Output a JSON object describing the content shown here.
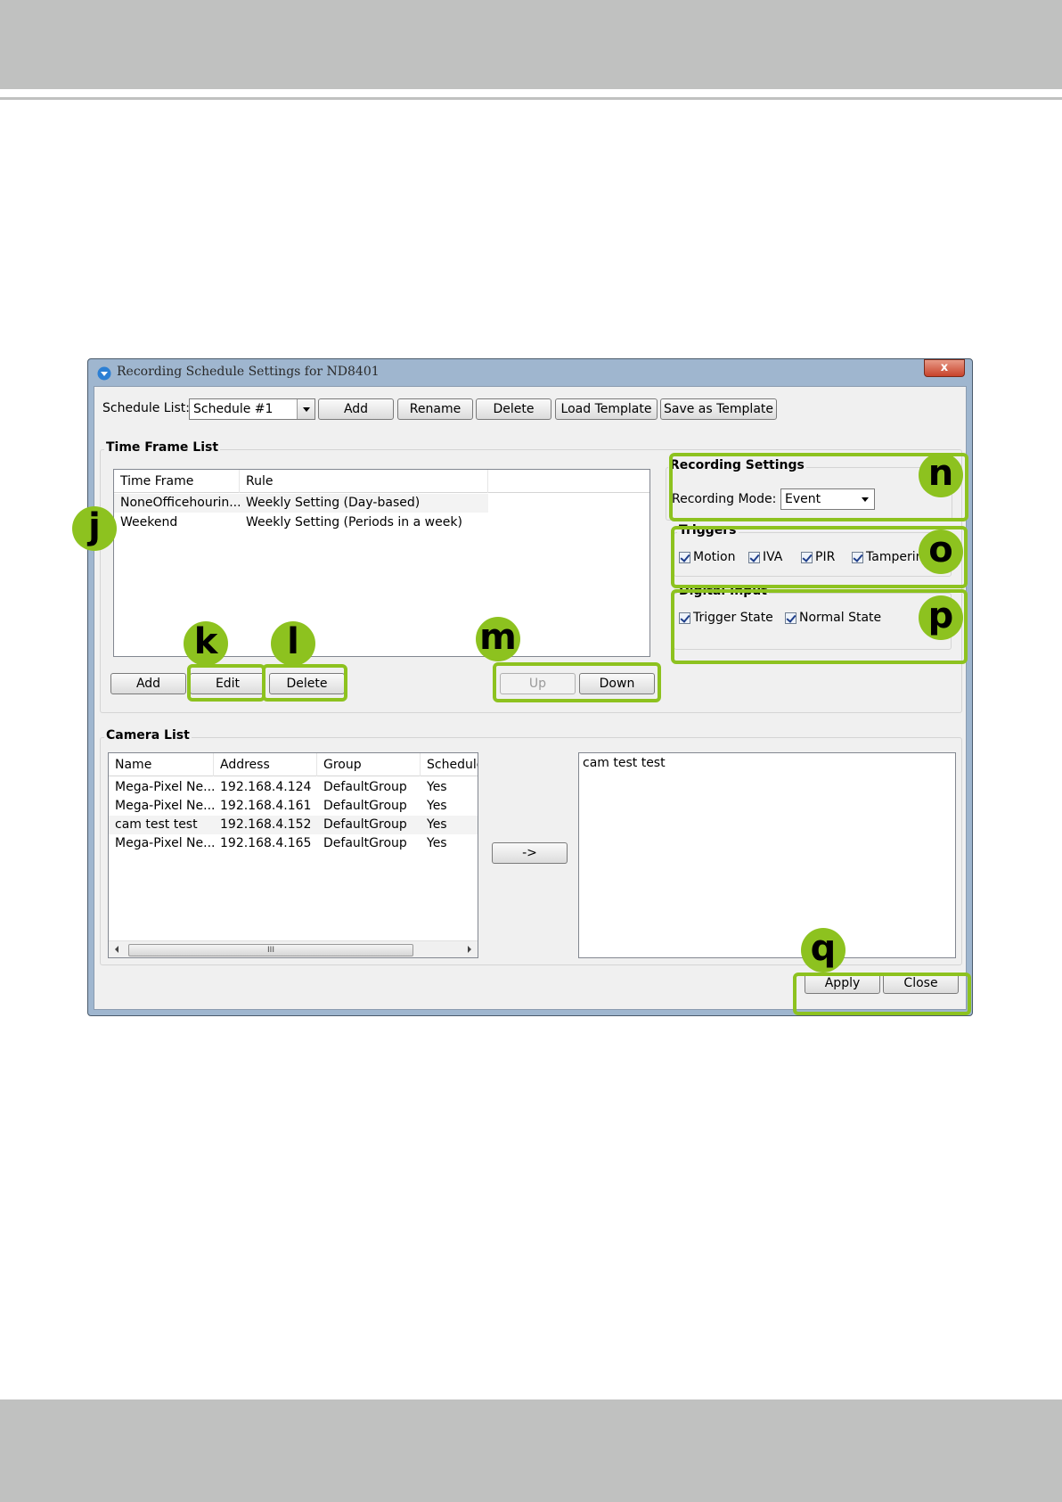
{
  "window": {
    "title": "Recording Schedule Settings for ND8401",
    "close_glyph": "x"
  },
  "schedule": {
    "label": "Schedule List:",
    "selected": "Schedule #1",
    "buttons": {
      "add": "Add",
      "rename": "Rename",
      "delete": "Delete",
      "load_template": "Load Template",
      "save_template": "Save as Template"
    }
  },
  "time_frame": {
    "title": "Time Frame List",
    "columns": [
      "Time Frame",
      "Rule"
    ],
    "rows": [
      [
        "NoneOfficehourin...",
        "Weekly Setting (Day-based)"
      ],
      [
        "Weekend",
        "Weekly Setting (Periods in a week)"
      ]
    ],
    "buttons": {
      "add": "Add",
      "edit": "Edit",
      "delete": "Delete",
      "up": "Up",
      "down": "Down"
    }
  },
  "recording_settings": {
    "title": "Recording Settings",
    "mode_label": "Recording Mode:",
    "mode_value": "Event"
  },
  "triggers": {
    "title": "Triggers",
    "items": [
      "Motion",
      "IVA",
      "PIR",
      "Tampering"
    ]
  },
  "digital_input": {
    "title": "Digital Input",
    "items": [
      "Trigger State",
      "Normal State"
    ]
  },
  "camera_list": {
    "title": "Camera List",
    "columns": [
      "Name",
      "Address",
      "Group",
      "Schedule"
    ],
    "rows": [
      [
        "Mega-Pixel Ne...",
        "192.168.4.124",
        "DefaultGroup",
        "Yes"
      ],
      [
        "Mega-Pixel Ne...",
        "192.168.4.161",
        "DefaultGroup",
        "Yes"
      ],
      [
        "cam test test",
        "192.168.4.152",
        "DefaultGroup",
        "Yes"
      ],
      [
        "Mega-Pixel Ne...",
        "192.168.4.165",
        "DefaultGroup",
        "Yes"
      ]
    ],
    "scroll_thumb": "III",
    "move_button": "->",
    "selected_items": [
      "cam test test"
    ]
  },
  "footer": {
    "apply": "Apply",
    "close": "Close"
  },
  "callouts": [
    "j",
    "k",
    "l",
    "m",
    "n",
    "o",
    "p",
    "q"
  ],
  "colors": {
    "callout": "#8dc21f",
    "band": "#c0c1c0"
  }
}
